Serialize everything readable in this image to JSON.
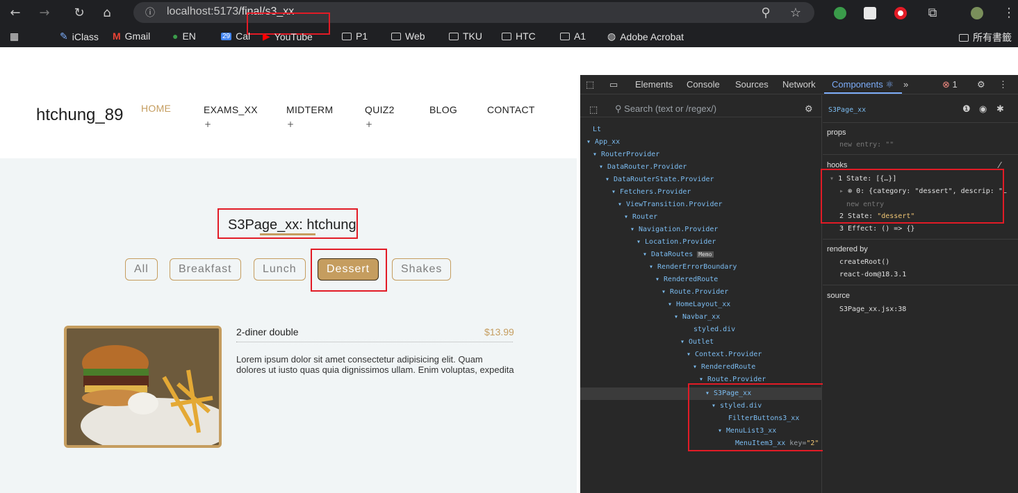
{
  "browser": {
    "url_host": "localhost:517",
    "url_host_tail": "3",
    "url_path": "/final/s3_xx",
    "bookmarks": [
      "iClass",
      "Gmail",
      "EN",
      "Cal",
      "YouTube",
      "P1",
      "Web",
      "TKU",
      "HTC",
      "A1",
      "Adobe Acrobat"
    ],
    "all_bookmarks": "所有書籤",
    "cal_badge": "29"
  },
  "site": {
    "brand": "htchung_89",
    "nav": [
      "HOME",
      "EXAMS_XX",
      "MIDTERM",
      "QUIZ2",
      "BLOG",
      "CONTACT"
    ],
    "nav_plus": "+",
    "page_title": "S3Page_xx: htchung",
    "filters": [
      "All",
      "Breakfast",
      "Lunch",
      "Dessert",
      "Shakes"
    ],
    "active_filter": "Dessert",
    "item": {
      "name": "2-diner double",
      "price": "$13.99",
      "desc": "Lorem ipsum dolor sit amet consectetur adipisicing elit. Quam dolores ut iusto quas quia dignissimos ullam. Enim voluptas, expedita"
    }
  },
  "devtools": {
    "tabs": [
      "Elements",
      "Console",
      "Sources",
      "Network",
      "Components ⚛",
      "»"
    ],
    "error_count": "1",
    "search_placeholder": "Search (text or /regex/)",
    "tree": [
      "Lt",
      "▾ App_xx",
      "▾ RouterProvider",
      "▾ DataRouter.Provider",
      "▾ DataRouterState.Provider",
      "▾ Fetchers.Provider",
      "▾ ViewTransition.Provider",
      "▾ Router",
      "▾ Navigation.Provider",
      "▾ Location.Provider",
      "▾ DataRoutes",
      "▾ RenderErrorBoundary",
      "▾ RenderedRoute",
      "▾ Route.Provider",
      "▾ HomeLayout_xx",
      "▾ Navbar_xx",
      "styled.div",
      "▾ Outlet",
      "▾ Context.Provider",
      "▾ RenderedRoute",
      "▾ Route.Provider",
      "▾ S3Page_xx",
      "▾ styled.div",
      "FilterButtons3_xx",
      "▾ MenuList3_xx",
      "MenuItem3_xx"
    ],
    "memo_badge": "Memo",
    "key_attr": "key",
    "key_val": "\"2\"",
    "panel": {
      "component": "S3Page_xx",
      "props_label": "props",
      "new_entry": "new entry: \"\"",
      "hooks_label": "hooks",
      "hook1": "1 State: [{…}]",
      "hook1_item": "0: {category: \"dessert\", descrip: \"L",
      "hook_new_entry": "new entry",
      "hook2_label": "2 State:",
      "hook2_val": "\"dessert\"",
      "hook3": "3 Effect: () => {}",
      "rendered_by_label": "rendered by",
      "rendered_by": [
        "createRoot()",
        "react-dom@18.3.1"
      ],
      "source_label": "source",
      "source": "S3Page_xx.jsx:38"
    }
  }
}
